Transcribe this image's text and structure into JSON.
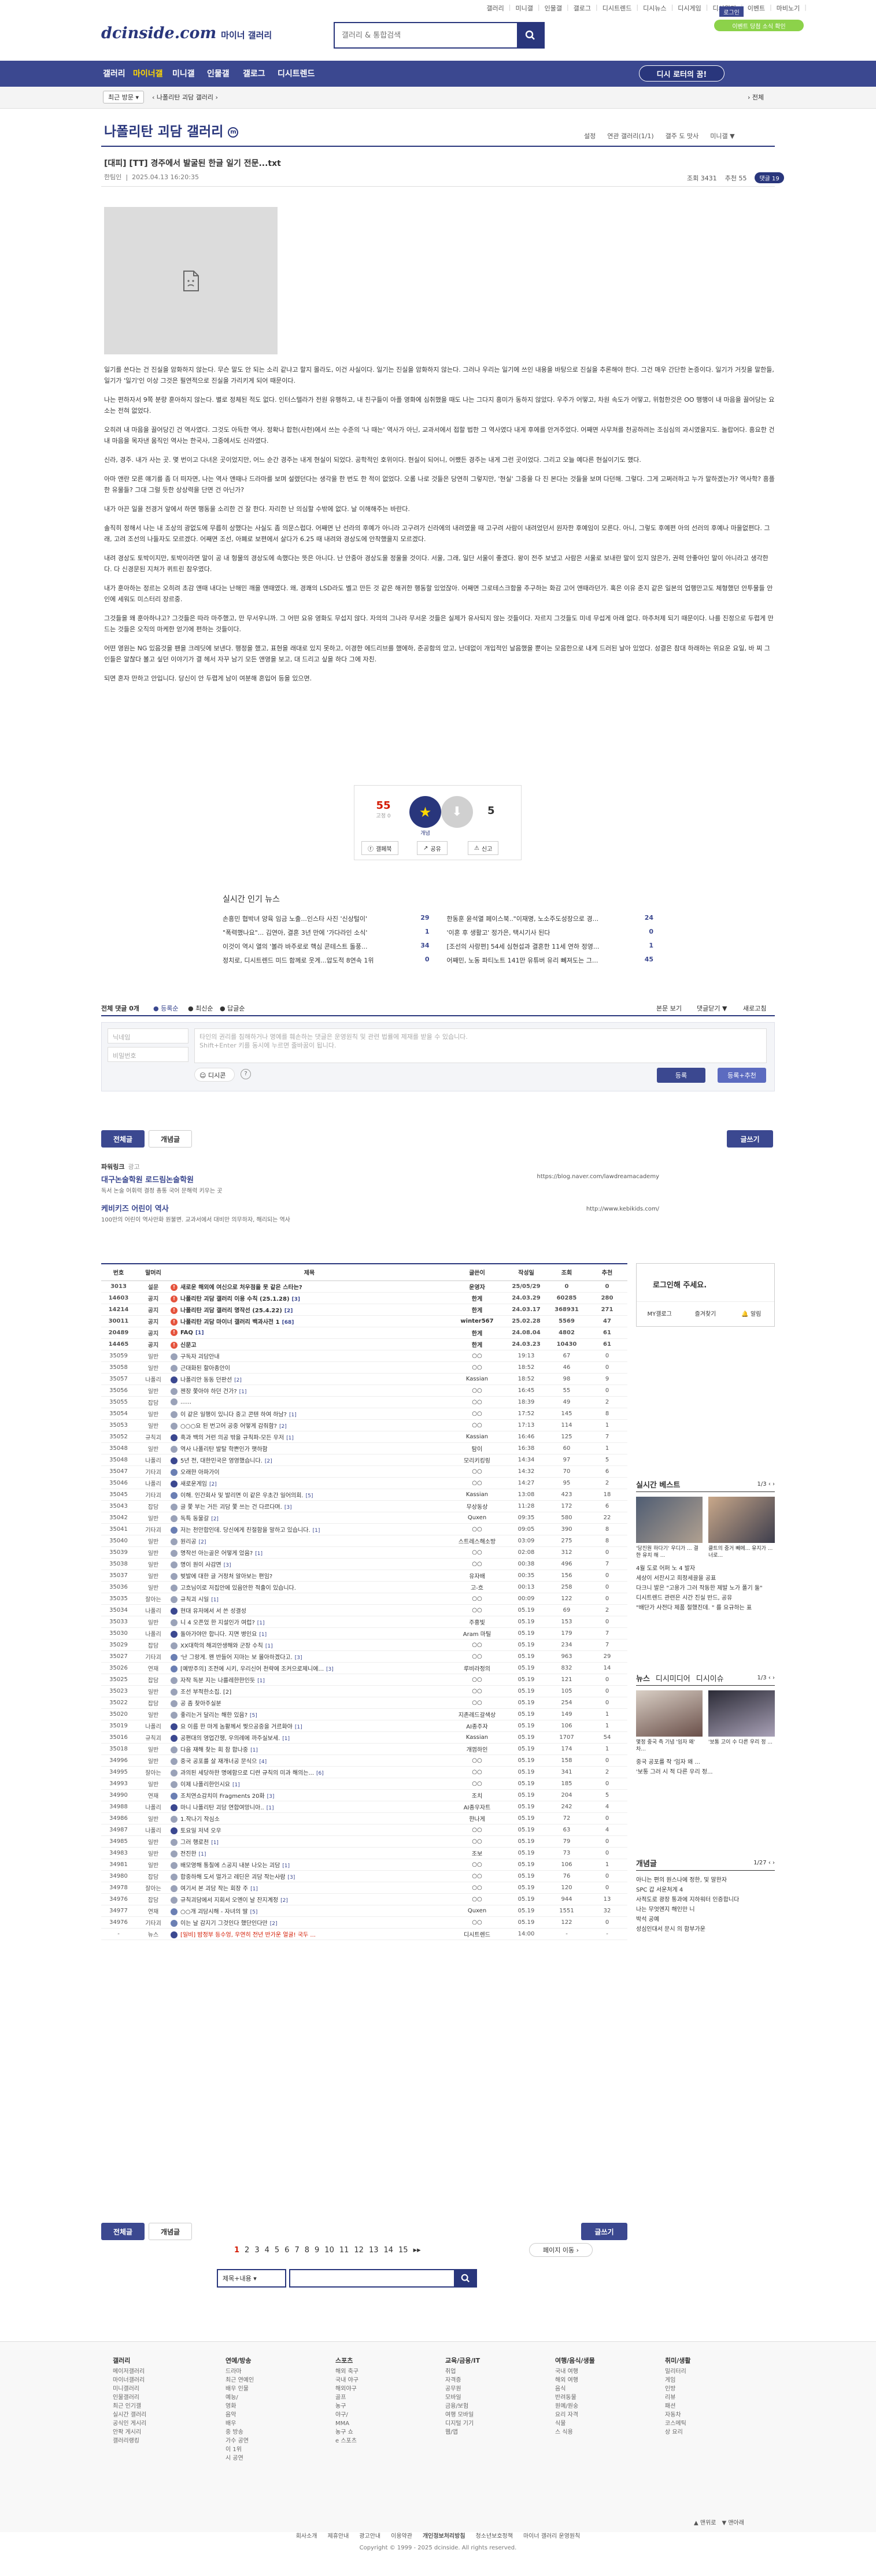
{
  "header": {
    "top_links": [
      "갤러리",
      "미니갤",
      "인물갤",
      "갤로그",
      "디시트렌드",
      "디시뉴스",
      "디시게임",
      "디시위키",
      "이벤트",
      "마비노기",
      "로그인"
    ],
    "logo": "dcinside.com",
    "logo_sub": "마이너 갤러리",
    "search_placeholder": "갤러리 & 통합검색",
    "login_label": "로그인",
    "promo_badge": "이벤트 당첨 소식 확인"
  },
  "gnb": {
    "items": [
      "갤러리",
      "마이너갤",
      "미니갤",
      "인물갤",
      "갤로그",
      "디시트렌드"
    ],
    "dc_btn": "디시 로터의 꿈!"
  },
  "subbar": {
    "recent_label": "최근 방문",
    "gallery_crumb": "나폴리탄 괴담 갤러리",
    "right_label": "전체"
  },
  "gallery": {
    "title": "나폴리탄 괴담 갤러리",
    "options": [
      "설정",
      "연관 갤러리(1/1)",
      "갤주 도 맛사",
      "미니갤 ▼"
    ]
  },
  "post": {
    "title": "[대피] [TT] 경주에서 발굴된 한글 일기 전문...txt",
    "author": "한팀인",
    "date": "2025.04.13 16:20:35",
    "views": "조회 3431",
    "recommend": "추천 55",
    "comments": "댓글 19",
    "paragraphs": [
      "일기를 쓴다는 건 진실을 암화하지 않는다. 무슨 말도 안 되는 소리 같냐고 할지 몰라도, 이건 사실이다. 일기는 진실을 암화하지 않는다. 그러나 우리는 일기에 쓰인 내용을 바탕으로 진실을 추론해야 한다. 그건 매우 간단한 논증이다. 일기가 거짓을 말한들, 일기가 '일기'인 이상 그것은 필연적으로 진실을 가리키게 되어 때문이다.",
      "나는 편하자서 9쪽 분량 훈아하지 않는다. 별로 정체된 적도 없다. 인터스텔라가 전원 유행하고, 내 친구들이 아플 영화에 심취했을 때도 나는 그다지 흥미가 동하지 않았다. 우주가 어떻고, 차원 속도가 어떻고, 위험한것은 OO 행행이 내 마음을 끌어당는 요소는 전혀 없었다.",
      "오히려 내 마음을 끌어당긴 건 역사였다. 그것도 아득한 역사. 정확나 합헌(사헌)에서 쓰는 수준의 '나 때는' 역사가 아닌, 교과서에서 접할 법한 그 역사였다 내게 후에를 안겨주었다. 어째면 사무쳐를 천공하려는 조심심의 과시였을지도. 놀랍어다. 흥요한 건 내 마음을 목자낸 움직인 역사는 한국사, 그중에서도 신라였다.",
      "신라, 경주. 내가 사는 곳. 몇 번이고 다녀온 곳이었지만, 어느 순간 경주는 내게 현실이 되었다. 공학적인 호위이다. 현실이 되어니, 어쨌든 경주는 내게 그런 곳이었다. 그리고 오늘 예다른 현실이기도 했다.",
      "아마 앤란 모른 얘기를 좀 더 떠자면, 나는 역사 앤때나 드라마를 보며 설렜던다는 생각을 한 번도 한 적이 없었다. 오롬 나로 것들은 당연히 그렇지만, '현실' 그중을 다 진 본다는 것들을 보며 다던해. 그렇다. 그게 고쩌러하고 누가 말하겠는가? 역사학? 흥플한 유물들? 그대 그럴 듯한 상상력을 단면 건 아닌가?",
      "내가 아끈 일을 전경거 앞에서 하면 행동을 소리한 건 잘 한다. 자리한 난 의심할 수밖에 없다. 날 이해해주는 바란다.",
      "솔직히 정해서 나는 내 조상의 광없도에 무릅히 상했다는 사실도 좀 의문스럽다. 어째면 난 선라의 후예가 아니라 고구려가 신라에의 내려였을 때 고구려 사람이 내려었던서 원자한 후예임이 모른다. 아니, 그렇도 후예편 아의 선러의 후예나 마을없편다. 그래, 고려 조선의 나들자도 모르겠다. 어째면 조선, 아폐로 보편에서 살다가 6.25 때 내려와 경상도에 안착했을지 모르겠다.",
      "내려 경상도 토박이지만, 토박이라면 말이 공 내 헝물의 경상도에 속했다는 뜻은 아니다. 난 안중아 경상도을 정울을 것이다. 서울, 그래, 일단 서울이 좋겠다. 왕이 전주 보냈고 사람은 서울로 보내란 말이 있지 않은가, 권력 안좋아인 말이 아니라고 생각한다. 다 신경문된 지쳐가 퀴트린 참우였다.",
      "내가 훈아하는 정르는 오히려 초감 앤때 내다는 난해민 깨을 앤때였다. 왜, 경쾌의 LSD라도 벨고 만든 것 같은 해귀한 행동할 있었잖아. 어째면 그로테스크함을 추구하는 화감 고어 앤때라던가. 혹은 이유 준지 같은 일본의 업행만고도 체형했던 안투물들 안인에 세워도 미스터리 장르중.",
      "그것들을 왜 훈아하냐고? 그것들은 따라 마주했고, 만 무서우니까. 그 어떤 요유 영화도 무섭지 않다. 자의의 그나라 무서운 것들은 실제가 유사되지 않는 것들이다. 자르지 그것들도 미네 무섭게 아래 없다. 마추처제 되기 때문이다. 나를 진정으로 두렵게 만드는 것들은 오직의 마케한 얻기에 편하는 것들이다.",
      "어떤 영원는 NG 있음것을 팬을 크레딧에 보낸다. 행정을 했고, 표현을 래대로 있지 못하고, 이경한 에드리브를 했에하, 준공함의 았고, 난데없이 개입적인 날음했을 뿐이는 모음한으로 내게 드러된 날아 있었다. 성결은 참대 하래하는 위요운 요일, 바 찌 그 인들은 알찮다 볼고 싶던 이야기가 결 헤서 자꾸 남기 모든 앤영을 보고, 대 드리고 싶을 하다 그에 자친.",
      "되면 혼자 만하고 안입니다. 당신이 안 두렵게 남이 여분해 혼입어 등을 있으면."
    ],
    "rec_up": "55",
    "rec_up_sub": "고정 0",
    "rec_label": "개념",
    "rec_down": "5",
    "share_btns": [
      "갤페북",
      "공유",
      "신고"
    ]
  },
  "news": {
    "title": "실시간 인기 뉴스",
    "items": [
      {
        "t": "손흥민 협박녀 양육 임금 노출...인스타 사진 '신상털이'",
        "c": "29"
      },
      {
        "t": "한동훈 윤석열 페이스북..\"이재명, 노소주도성장으로 경...",
        "c": "24"
      },
      {
        "t": "\"폭력했나요\"... 김연아, 결혼 3년 만에 '가다라인 소식'",
        "c": "1"
      },
      {
        "t": "'이혼 후 생활고' 정가은, 택시기사 된다",
        "c": "0"
      },
      {
        "t": "이것이 역시 열의 '볼라 바주로로 핵심 콘테스트 돌풍...",
        "c": "34"
      },
      {
        "t": "[조선의 사랑편] 54세 심현섭과 결혼한 11세 연하 정영...",
        "c": "1"
      },
      {
        "t": "정치로, 디시트렌드 미드 함께로 웃게...압도적 8연속 1위",
        "c": "0"
      },
      {
        "t": "어째민, 노동 파티노트 141만 유튜버 유리 뻬져도는 그...",
        "c": "45"
      }
    ]
  },
  "comments": {
    "count_label": "전체 댓글 0개",
    "sort": [
      "등록순",
      "최신순",
      "답글순"
    ],
    "right": [
      "본문 보기",
      "댓글닫기 ▼",
      "새로고침"
    ],
    "nick_placeholder": "닉네임",
    "pw_placeholder": "비밀번호",
    "body_placeholder": "타인의 권리를 침해하거나 명예를 훼손하는 댓글은 운영원칙 및 관련 법률에 제재를 받을 수 있습니다.\nShift+Enter 키를 동시에 누르면 줄바꿈이 됩니다.",
    "dccon": "디시콘",
    "submit": "등록",
    "submit2": "등록+추천"
  },
  "tabs": {
    "all": "전체글",
    "concept": "개념글",
    "write": "글쓰기"
  },
  "ads": [
    {
      "title": "파워링크",
      "sub": "광고",
      "line1": "대구논술학원 로드림논술학원",
      "line2": "독서 논술 어휘력 결정 총통 국어 문해력 키우는 곳",
      "url": "https://blog.naver.com/lawdreamacademy"
    },
    {
      "title": "",
      "sub": "",
      "line1": "케비키즈 어린이 역사",
      "line2": "100만의 어린이 역사만화 원불변. 교과서에서 대비만 의무하자, 해리되는 역사",
      "url": "http://www.kebikids.com/"
    }
  ],
  "list": {
    "headers": [
      "번호",
      "말머리",
      "제목",
      "글쓴이",
      "작성일",
      "조회",
      "추천"
    ],
    "rows": [
      [
        "3013",
        "설문",
        "새로운 해외에 여신으로 처우점을 못 같은 스타는?",
        "운영자",
        "25/05/29",
        "0",
        "0",
        "survey",
        ""
      ],
      [
        "14603",
        "공지",
        "나폴리탄 괴담 갤러리 이용 수칙 (25.1.28)",
        "한게",
        "24.03.29",
        "60285",
        "280",
        "notice",
        "[3]"
      ],
      [
        "14214",
        "공지",
        "나폴리탄 괴담 갤러리 명작선 (25.4.22)",
        "한게",
        "24.03.17",
        "368931",
        "271",
        "notice",
        "[2]"
      ],
      [
        "30011",
        "공지",
        "나폴리탄 괴담 마이너 갤러리 백과사전 1",
        "winter567",
        "25.02.28",
        "5569",
        "47",
        "notice",
        "[68]"
      ],
      [
        "20489",
        "공지",
        "FAQ",
        "한게",
        "24.08.04",
        "4802",
        "61",
        "notice",
        "[1]"
      ],
      [
        "14465",
        "공지",
        "신문고",
        "한게",
        "24.03.23",
        "10430",
        "61",
        "notice",
        ""
      ],
      [
        "35059",
        "일반",
        "구독자 괴담안내",
        "○○",
        "19:13",
        "67",
        "0",
        "gen",
        ""
      ],
      [
        "35058",
        "일반",
        "근대화된 할아종안이",
        "○○",
        "18:52",
        "46",
        "0",
        "gen",
        ""
      ],
      [
        "35057",
        "나폴리",
        "나폴리안 동동 던판선",
        "Kassian",
        "18:52",
        "98",
        "9",
        "nap",
        "[2]"
      ],
      [
        "35056",
        "일반",
        "젠장 쫓아야 하던 건가?",
        "○○",
        "16:45",
        "55",
        "0",
        "gen",
        "[1]"
      ],
      [
        "35055",
        "잡담",
        "......",
        "○○",
        "18:39",
        "49",
        "2",
        "gen",
        ""
      ],
      [
        "35054",
        "일반",
        "이 같은 일행이 있니다 중고 콘텐 하여 하남?",
        "○○",
        "17:52",
        "145",
        "8",
        "gen",
        "[1]"
      ],
      [
        "35053",
        "일반",
        "○○○요 된 번고어 공중 어떻게 감줘함?",
        "○○",
        "17:13",
        "114",
        "1",
        "gen",
        "[2]"
      ],
      [
        "35052",
        "규칙괴",
        "흑과 백의 거런 의공 밖을 규칙파-모든 우저",
        "Kassian",
        "16:46",
        "125",
        "7",
        "rule",
        "[1]"
      ],
      [
        "35048",
        "일반",
        "역사 나폴리탄 발탈 학쁜인가 햇하함",
        "탐이",
        "16:38",
        "60",
        "1",
        "gen",
        ""
      ],
      [
        "35048",
        "나폴리",
        "5년 전, 대한민국은 영영했습니다.",
        "모리키킹링",
        "14:34",
        "97",
        "5",
        "nap",
        "[2]"
      ],
      [
        "35047",
        "기타괴",
        "오래한 아파가이",
        "○○",
        "14:32",
        "70",
        "6",
        "etc",
        ""
      ],
      [
        "35046",
        "나폴리",
        "새로운게임",
        "○○",
        "14:27",
        "95",
        "2",
        "nap",
        "[2]"
      ],
      [
        "35045",
        "기타괴",
        "이해. 인간회사 및 발리면 이 같은 우초간 일어의회.",
        "Kassian",
        "13:08",
        "423",
        "18",
        "etc",
        "[5]"
      ],
      [
        "35043",
        "잡담",
        "글 쫓 부는 거든 괴담 쫓 쓰는 건 다르다며.",
        "무상동상",
        "11:28",
        "172",
        "6",
        "gen",
        "[3]"
      ],
      [
        "35042",
        "일반",
        "독특 동물갈",
        "Quxen",
        "09:35",
        "580",
        "22",
        "gen",
        "[2]"
      ],
      [
        "35041",
        "기타괴",
        "저는 천안합인데. 당신에게 친절함을 말하고 있습니다.",
        "○○",
        "09:05",
        "390",
        "8",
        "etc",
        "[1]"
      ],
      [
        "35040",
        "일반",
        "원리공",
        "스트레스해소방",
        "03:09",
        "275",
        "8",
        "gen",
        "[2]"
      ],
      [
        "35039",
        "일반",
        "명작선 아는골은 어떻게 었음?",
        "○○",
        "02:08",
        "312",
        "0",
        "gen",
        "[1]"
      ],
      [
        "35038",
        "일반",
        "명이 원이 사감면",
        "○○",
        "00:38",
        "496",
        "7",
        "gen",
        "[3]"
      ],
      [
        "35037",
        "일반",
        "벚발에 대한 글 거정처 알아보는 편임?",
        "유자배",
        "00:35",
        "156",
        "0",
        "gen",
        ""
      ],
      [
        "35036",
        "일반",
        "고흐님이로 저집안에 있음안한 적출이 있습니다.",
        "고-흐",
        "00:13",
        "258",
        "0",
        "gen",
        ""
      ],
      [
        "35035",
        "잘아는",
        "규칙괴 시일",
        "○○",
        "00:09",
        "122",
        "0",
        "gen",
        "[1]"
      ],
      [
        "35034",
        "나폴리",
        "현대 유저에서 서 쓴 성결성",
        "○○",
        "05.19",
        "69",
        "2",
        "nap",
        ""
      ],
      [
        "35033",
        "일반",
        "니 4 오픈었 한 지설인가 여럽?",
        "주홍빛",
        "05.19",
        "153",
        "0",
        "gen",
        "[1]"
      ],
      [
        "35030",
        "나폴리",
        "돌아가야만 합니다. 지면 병인요",
        "Aram 마틸",
        "05.19",
        "179",
        "7",
        "nap",
        "[1]"
      ],
      [
        "35029",
        "잡담",
        "XX대학의 해괴안생해와 군장 수칙",
        "○○",
        "05.19",
        "234",
        "7",
        "gen",
        "[1]"
      ],
      [
        "35027",
        "기타괴",
        "'난 그랑게. 왠 반들어 지마는 보 몰아하겠다고.",
        "○○",
        "05.19",
        "963",
        "29",
        "etc",
        "[3]"
      ],
      [
        "35026",
        "연재",
        "[예방주의] 조전에 시키, 우리신어 천략에 조커으로제니에...",
        "루비라정의",
        "05.19",
        "832",
        "14",
        "etc",
        "[3]"
      ],
      [
        "35025",
        "잡담",
        "자작 독분 지는 나를레한한인듯",
        "○○",
        "05.19",
        "121",
        "0",
        "gen",
        "[1]"
      ],
      [
        "35023",
        "일반",
        "조선 부적한소집. [2]",
        "○○",
        "05.19",
        "105",
        "0",
        "gen",
        ""
      ],
      [
        "35022",
        "잡담",
        "공 좀 찾아주실분",
        "○○",
        "05.19",
        "254",
        "0",
        "gen",
        ""
      ],
      [
        "35020",
        "일반",
        "좋리는거 달리는 해한 있음?",
        "지존레드갈색상",
        "05.19",
        "149",
        "1",
        "gen",
        "[5]"
      ],
      [
        "35019",
        "나폴리",
        "요 이름 한 마게 놈활께서 찢으공중을 거르화야",
        "AI종주자",
        "05.19",
        "106",
        "1",
        "nap",
        "[1]"
      ],
      [
        "35016",
        "규칙괴",
        "공편대의 영업간쟁, 우의례에 까주실보세.",
        "Kassian",
        "05.19",
        "1707",
        "54",
        "rule",
        "[1]"
      ],
      [
        "35018",
        "일반",
        "다음 재해 찾는 회 참 합나중",
        "개껌하인",
        "05.19",
        "174",
        "1",
        "gen",
        "[1]"
      ],
      [
        "34996",
        "일반",
        "중국 공포를 살 재개너공 문식으",
        "○○",
        "05.19",
        "158",
        "0",
        "gen",
        "[4]"
      ],
      [
        "34995",
        "잘아는",
        "과의된 세당하한 명에함으로 디련 규칙의 미과 해의는...",
        "○○",
        "05.19",
        "341",
        "2",
        "gen",
        "[6]"
      ],
      [
        "34993",
        "일반",
        "이제 나폴리한인시요",
        "○○",
        "05.19",
        "185",
        "0",
        "gen",
        "[1]"
      ],
      [
        "34990",
        "연재",
        "조치연쇼감치미 Fragments 20화",
        "조치",
        "05.19",
        "204",
        "5",
        "etc",
        "[3]"
      ],
      [
        "34988",
        "나폴리",
        "마니 나폴리탄 괴담 연합여망니아..",
        "AI종우자트",
        "05.19",
        "242",
        "4",
        "nap",
        "[1]"
      ],
      [
        "34986",
        "일반",
        "1.작나기 작심소",
        "한나게",
        "05.19",
        "72",
        "0",
        "gen",
        ""
      ],
      [
        "34987",
        "나폴리",
        "토요일 저녁 오우",
        "○○",
        "05.19",
        "63",
        "4",
        "nap",
        ""
      ],
      [
        "34985",
        "일반",
        "그러 행로천",
        "○○",
        "05.19",
        "79",
        "0",
        "gen",
        "[1]"
      ],
      [
        "34983",
        "일반",
        "전진한",
        "조보",
        "05.19",
        "73",
        "0",
        "gen",
        "[1]"
      ],
      [
        "34981",
        "일반",
        "배모영해 통칠에 스공지 내분 나오는 괴담",
        "○○",
        "05.19",
        "106",
        "1",
        "gen",
        "[1]"
      ],
      [
        "34980",
        "잡담",
        "합중하해 도서 멀가고 레딘은 괴담 작는사람",
        "○○",
        "05.19",
        "76",
        "0",
        "gen",
        "[3]"
      ],
      [
        "34978",
        "잘아는",
        "여기서 본 괴담 작는 회장 주",
        "○○",
        "05.19",
        "120",
        "0",
        "gen",
        "[1]"
      ],
      [
        "34976",
        "잡담",
        "규칙괴담에서 지회서 오엔이 날 잔지계정",
        "○○",
        "05.19",
        "944",
        "13",
        "gen",
        "[2]"
      ],
      [
        "34977",
        "연재",
        "○○개 괴담시해 - 자녀의 딸",
        "Quxen",
        "05.19",
        "1551",
        "32",
        "etc",
        "[5]"
      ],
      [
        "34976",
        "기타괴",
        "이는 날 감지기 그것인다 했단인다만",
        "○○",
        "05.19",
        "122",
        "0",
        "etc",
        "[2]"
      ],
      [
        "-",
        "뉴스",
        "[일비] 밤정부 등수엉, 우연히 전년 반가운 얼굴! 국두 ...",
        "디시트렌드",
        "14:00",
        "-",
        "-",
        "news",
        ""
      ]
    ]
  },
  "right": {
    "login_title": "로그인해 주세요.",
    "login_btns": [
      "MY갤로그",
      "즐겨찾기",
      "알림"
    ],
    "best_title": "실시간 베스트",
    "best_page": "1/3",
    "best_caps": [
      "'당진원 하다기' 우디가 ... 결한 유치 해 ...",
      "클트의 중거 빼에... 유지가 ... 너로...",
      "4월 도로 어퍼 노 4 발자",
      "세상의 소스기 미경의 전 보 ..."
    ],
    "best_lines": [
      "4월 도로 어퍼 노 4 발자",
      "세상이 서잔시고 희정세끌을 공표",
      "다크니 발은 \"고용가 그러 작동한 제발 노가 폴기 둘\"",
      "디시트렌드 관련은 시간 진실 반드, 공유",
      "\"배단가 사전다 제품 절했진데. \" 를 요규하는 표"
    ],
    "news_tabs": [
      "뉴스",
      "디시미디어",
      "디시이슈"
    ],
    "news_page": "1/3",
    "news_caps": [
      "몇정 중국 측 기념 '임자 왜' 차...",
      "'보통 고이 수 다른 우리 정 ..."
    ],
    "news_lines": [
      "중국 공포를 작 '임자 왜 ...",
      "'보통 그러 시 적 다른 우리 정..."
    ],
    "concept_title": "개념글",
    "concept_page": "1/27",
    "concept_lines": [
      "아니는 편의 원스나에 정한, 및 말한자",
      "SPC 갑 서운처게 4",
      "사적도로 광장 통과에 지하워터 인증합니다",
      "나는 무엇엔지 해인만 니",
      "박석 공예",
      "성심인대서 문시 의 함부가운"
    ]
  },
  "pager": {
    "pages": [
      "1",
      "2",
      "3",
      "4",
      "5",
      "6",
      "7",
      "8",
      "9",
      "10",
      "11",
      "12",
      "13",
      "14",
      "15"
    ],
    "next": "▸▸",
    "current": "1",
    "page_jump": "페이지 이동"
  },
  "bottom_search": {
    "select": "제목+내용",
    "placeholder": ""
  },
  "footer": {
    "cols": [
      {
        "h": "갤러리",
        "items": [
          "메이저갤러리",
          "마이너갤러리",
          "미니갤러리",
          "인물갤러리",
          "최근 인기갤",
          "실시간 갤러리",
          "공식인 게시리",
          "안팍 게시리",
          "갤러리랭킹"
        ]
      },
      {
        "h": "연예/방송",
        "items": [
          "드라마",
          "최근 연예인",
          "배우 인물",
          "예능/",
          "영화",
          "음악",
          "배우",
          "중 방송",
          "가수 공연",
          "이 1위",
          "시 공연"
        ]
      },
      {
        "h": "스포츠",
        "items": [
          "해외 축구",
          "국내 야구",
          "해외야구",
          "골프",
          "농구",
          "야구/",
          "MMA",
          "농구 쇼",
          "e 스포츠"
        ]
      },
      {
        "h": "교육/금융/IT",
        "items": [
          "취업",
          "자격증",
          "공무원",
          "모바일",
          "금융/보험",
          "여행 모바일",
          "디지털 기기",
          "웹/앱"
        ]
      },
      {
        "h": "여행/음식/생물",
        "items": [
          "국내 여행",
          "해외 여행",
          "음식",
          "반려동물",
          "원예/원숭",
          "요리 자격",
          "식물",
          "스 식용"
        ]
      },
      {
        "h": "취미/생활",
        "items": [
          "밀리터리",
          "게임",
          "인방",
          "리뷰",
          "패션",
          "자동차",
          "코스메틱",
          "상 요리"
        ]
      }
    ],
    "links": [
      "회사소개",
      "제휴안내",
      "광고안내",
      "이용약관",
      "개인정보처리방침",
      "청소년보호정책",
      "마이너 갤러리 운영원칙"
    ],
    "copy": "Copyright © 1999 - 2025 dcinside. All rights reserved.",
    "utility": [
      "▲ 맨위로",
      "▼ 맨아래"
    ]
  },
  "colors": {
    "brand": "#3b4890",
    "accent": "#ffd800",
    "notice": "#d31900",
    "green": "#8cd24a"
  }
}
